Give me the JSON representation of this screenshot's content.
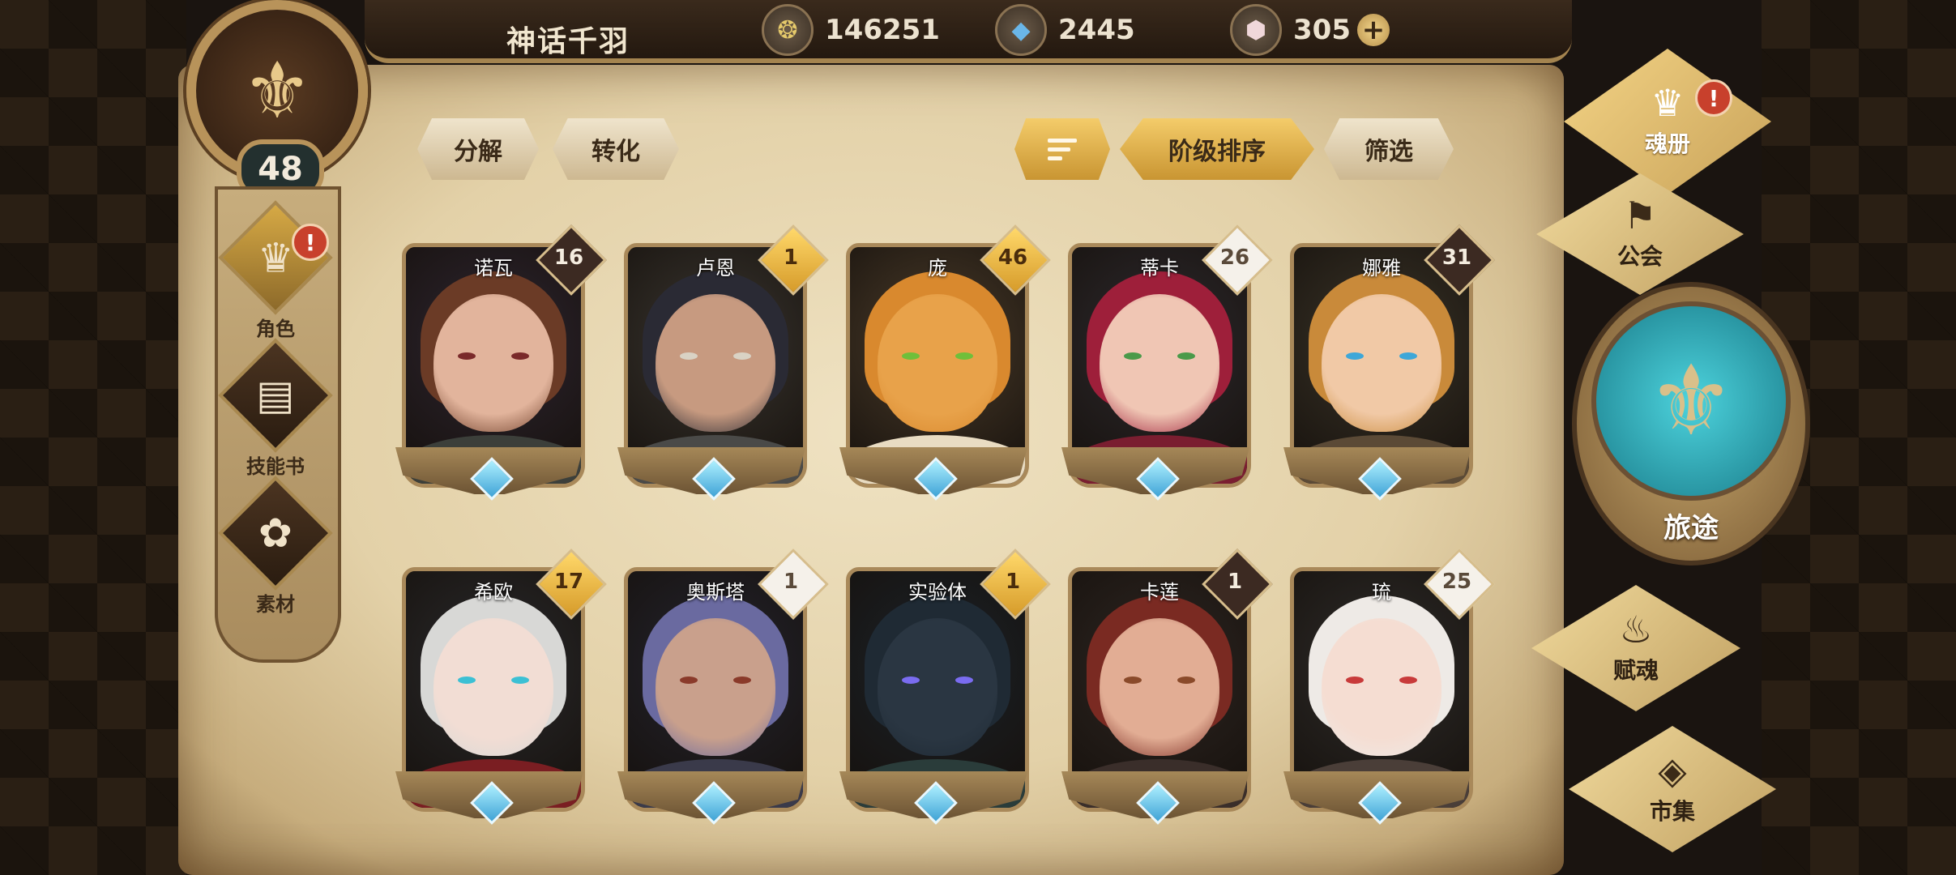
{
  "header": {
    "player_name": "神话千羽",
    "level": "48",
    "currencies": [
      {
        "icon": "gold-coin-icon",
        "glyph": "❂",
        "value": "146251"
      },
      {
        "icon": "blue-crystal-icon",
        "glyph": "◆",
        "value": "2445"
      },
      {
        "icon": "pink-gem-icon",
        "glyph": "⬢",
        "value": "305"
      }
    ],
    "plus": "+"
  },
  "left_nav": [
    {
      "label": "角色",
      "glyph": "♛",
      "alert": "!"
    },
    {
      "label": "技能书",
      "glyph": "▤"
    },
    {
      "label": "素材",
      "glyph": "✿"
    }
  ],
  "toolbar": {
    "decompose": "分解",
    "convert": "转化",
    "grade_sort": "阶级排序",
    "filter": "筛选"
  },
  "heroes": [
    {
      "name": "诺瓦",
      "level": "16",
      "badge": "dark",
      "hair": "#6b3b26",
      "skin": "#e2b49c",
      "eye": "#7a2a2a",
      "bg": "#2e2530",
      "cloth": "#3c3f3a"
    },
    {
      "name": "卢恩",
      "level": "1",
      "badge": "gold",
      "hair": "#2a2a34",
      "skin": "#c79a80",
      "eye": "#d9d2c4",
      "bg": "#3a3630",
      "cloth": "#4a4a48"
    },
    {
      "name": "庞",
      "level": "46",
      "badge": "gold",
      "hair": "#d9892e",
      "skin": "#e8a24a",
      "eye": "#6fbf3a",
      "bg": "#4b3c2a",
      "cloth": "#e9dcc2"
    },
    {
      "name": "蒂卡",
      "level": "26",
      "badge": "light",
      "hair": "#9e1f3a",
      "skin": "#f0c6b4",
      "eye": "#4a9a4a",
      "bg": "#2e2a2e",
      "cloth": "#7a1e30"
    },
    {
      "name": "娜雅",
      "level": "31",
      "badge": "dark",
      "hair": "#c98a3a",
      "skin": "#f1c9a6",
      "eye": "#3ea7d8",
      "bg": "#3a3428",
      "cloth": "#5b4a36"
    },
    {
      "name": "希欧",
      "level": "17",
      "badge": "gold",
      "hair": "#d8d8d6",
      "skin": "#f2ddd4",
      "eye": "#3cc0d4",
      "bg": "#2a2a2c",
      "cloth": "#7a1e22"
    },
    {
      "name": "奥斯塔",
      "level": "1",
      "badge": "light",
      "hair": "#6a6aa0",
      "skin": "#c9a08c",
      "eye": "#8a3a2a",
      "bg": "#24242e",
      "cloth": "#3a3a4a"
    },
    {
      "name": "实验体",
      "level": "1",
      "badge": "gold",
      "hair": "#1f2a34",
      "skin": "#2a3642",
      "eye": "#7a6cf0",
      "bg": "#1c2228",
      "cloth": "#2a3c3a"
    },
    {
      "name": "卡莲",
      "level": "1",
      "badge": "dark",
      "hair": "#7a2a22",
      "skin": "#e2ad94",
      "eye": "#8a4a2a",
      "bg": "#2e2622",
      "cloth": "#3a2e2a"
    },
    {
      "name": "琉",
      "level": "25",
      "badge": "light",
      "hair": "#eeeae6",
      "skin": "#f5ddd2",
      "eye": "#c83a3a",
      "bg": "#2e2c2a",
      "cloth": "#4a3e38"
    }
  ],
  "right_nav": [
    {
      "label": "魂册",
      "glyph": "♛",
      "alert": "!"
    },
    {
      "label": "公会",
      "glyph": "⚑"
    },
    {
      "label": "旅途",
      "glyph": "⚜"
    },
    {
      "label": "赋魂",
      "glyph": "♨"
    },
    {
      "label": "市集",
      "glyph": "◈"
    }
  ]
}
